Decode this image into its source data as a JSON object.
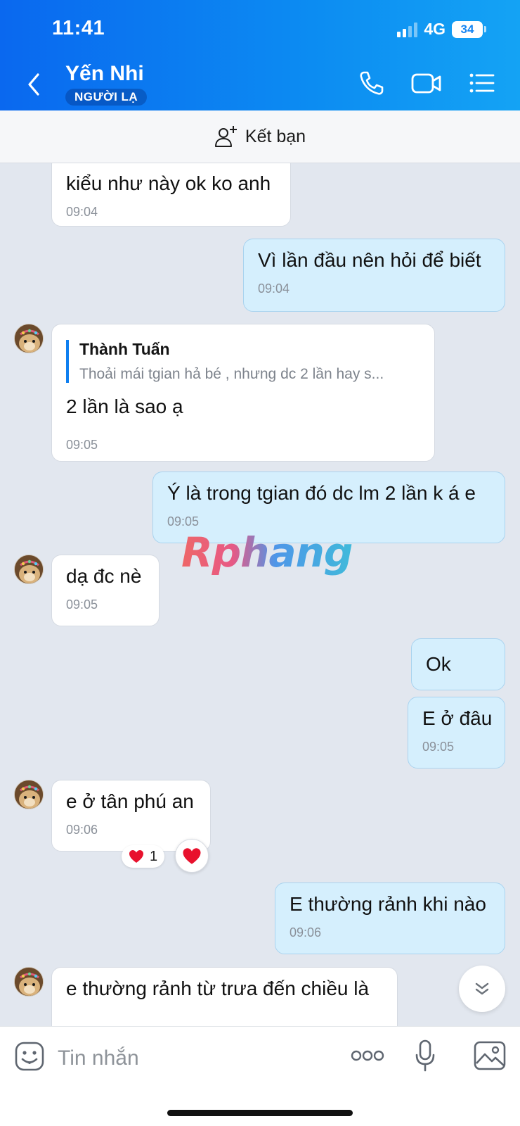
{
  "status_bar": {
    "time": "11:41",
    "network": "4G",
    "battery": "34"
  },
  "header": {
    "name": "Yến Nhi",
    "badge": "NGƯỜI LẠ"
  },
  "friend_bar": {
    "label": "Kết bạn"
  },
  "messages": [
    {
      "dir": "in",
      "text": "kiểu như này ok ko anh",
      "time": "09:04"
    },
    {
      "dir": "out",
      "text": "Vì lần đầu nên hỏi để biết",
      "time": "09:04"
    },
    {
      "dir": "in",
      "quote_name": "Thành Tuấn",
      "quote_text": "Thoải mái tgian hả bé , nhưng dc 2 lần hay s...",
      "text": "2 lần là sao ạ",
      "time": "09:05"
    },
    {
      "dir": "out",
      "text": "Ý là trong tgian đó dc lm 2 lần k á e",
      "time": "09:05"
    },
    {
      "dir": "in",
      "text": "dạ đc nè",
      "time": "09:05"
    },
    {
      "dir": "out",
      "text": "Ok"
    },
    {
      "dir": "out",
      "text": "E ở đâu",
      "time": "09:05"
    },
    {
      "dir": "in",
      "text": "e ở tân phú an",
      "time": "09:06",
      "reactions": "1"
    },
    {
      "dir": "out",
      "text": "E thường rảnh khi nào",
      "time": "09:06"
    },
    {
      "dir": "in",
      "text": "e thường rảnh từ trưa đến chiều là"
    }
  ],
  "watermark": "Rphang",
  "input": {
    "placeholder": "Tin nhắn"
  },
  "colors": {
    "header_start": "#0a68ef",
    "header_end": "#14a3f4",
    "outgoing_bubble": "#d5effd",
    "incoming_bubble": "#ffffff",
    "chat_bg": "#e2e7ef",
    "heart": "#e8112d"
  },
  "icons": [
    "back-icon",
    "phone-icon",
    "video-call-icon",
    "menu-icon",
    "add-friend-icon",
    "sticker-icon",
    "more-icon",
    "mic-icon",
    "image-icon",
    "heart-icon",
    "chevron-down-icon"
  ]
}
